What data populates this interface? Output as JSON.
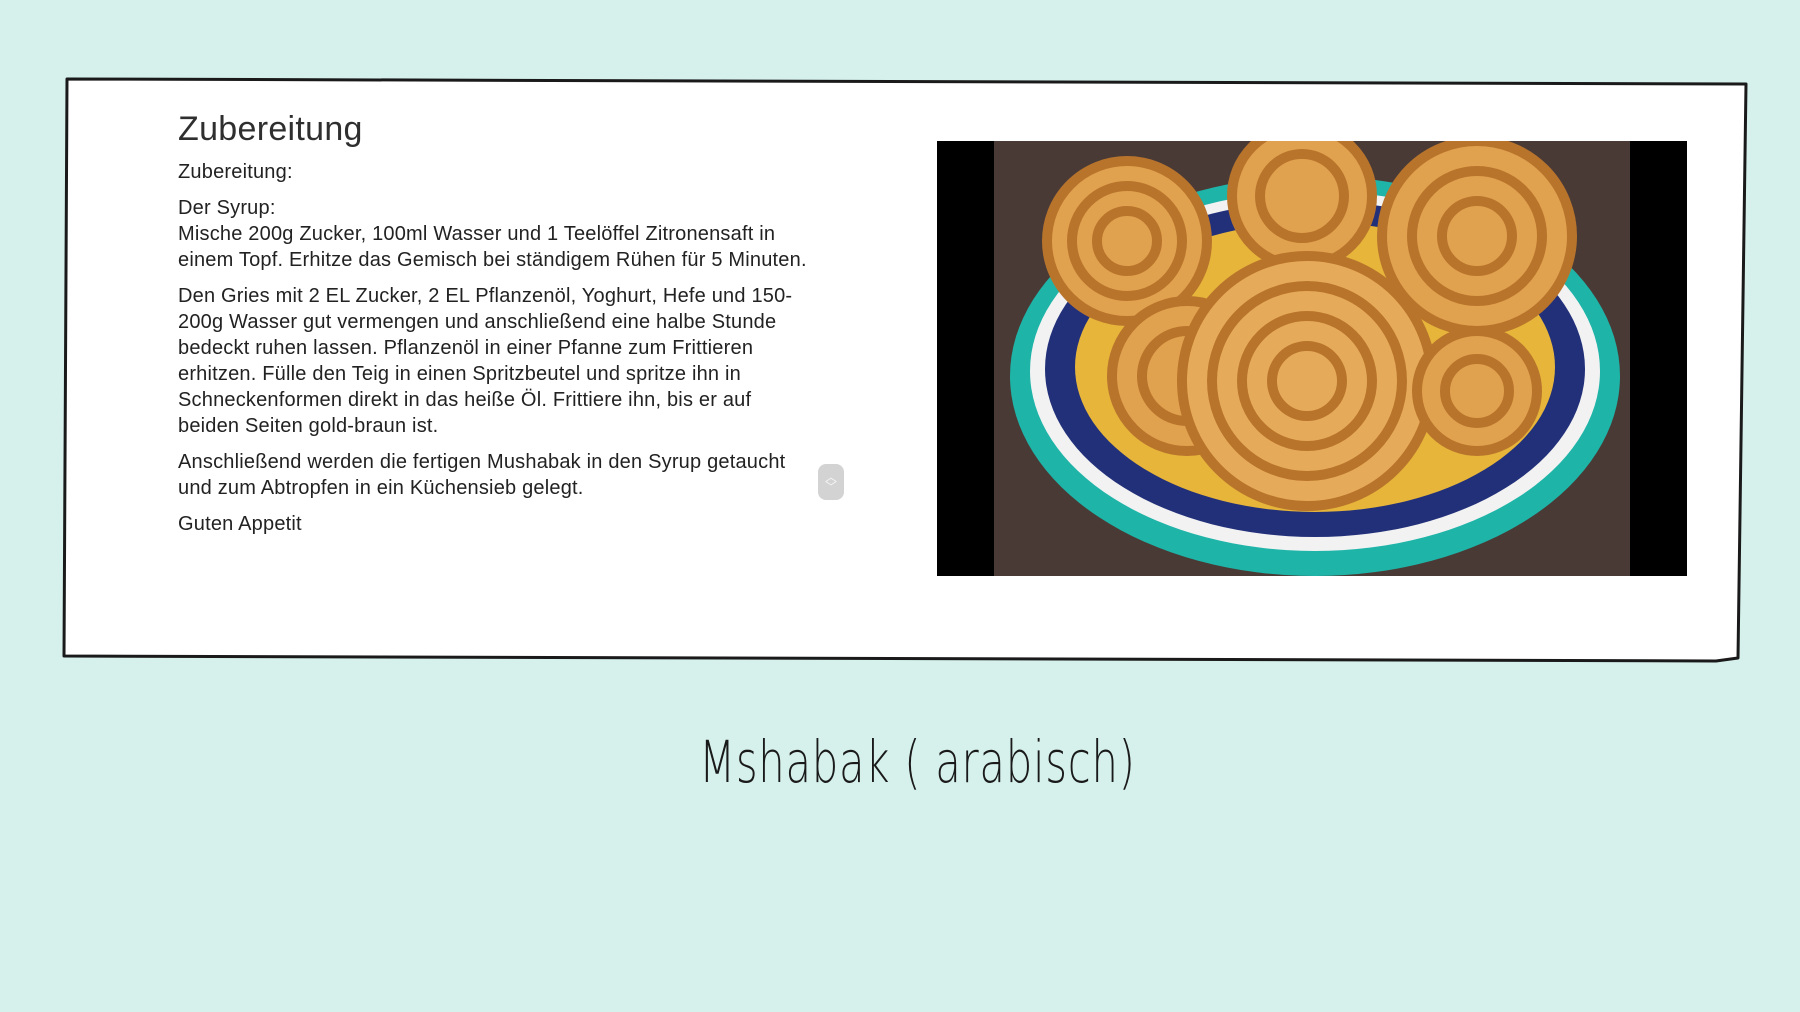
{
  "card": {
    "heading": "Zubereitung",
    "paragraphs": [
      "Zubereitung:",
      "Der Syrup:\nMische 200g Zucker, 100ml Wasser und 1 Teelöffel Zitronensaft in einem Topf. Erhitze das Gemisch bei ständigem Rühen für 5 Minuten.",
      "Den Gries mit 2 EL Zucker, 2 EL Pflanzenöl, Yoghurt, Hefe und 150-200g Wasser gut vermengen und anschließend eine halbe Stunde bedeckt ruhen lassen. Pflanzenöl in einer Pfanne zum Frittieren erhitzen. Fülle den Teig in einen Spritzbeutel und spritze ihn in Schneckenformen direkt in das heiße Öl. Frittiere ihn, bis er auf beiden Seiten gold-braun ist.",
      "Anschließend werden die fertigen Mushabak in den Syrup getaucht und zum Abtropfen in ein Küchensieb gelegt.",
      "Guten Appetit"
    ]
  },
  "title": "Mshabak ( arabisch)",
  "colors": {
    "background": "#d6f1ec",
    "card": "#ffffff",
    "plate_rim": "#1fb4a8",
    "pastry": "#e0a24f"
  }
}
